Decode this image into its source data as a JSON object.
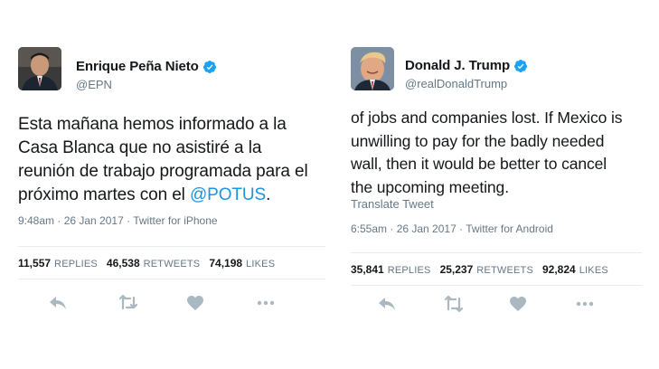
{
  "tweets": [
    {
      "display_name": "Enrique Peña Nieto",
      "handle": "@EPN",
      "text_before": "Esta mañana hemos informado a la\nCasa Blanca que no asistiré a la\nreunión de trabajo programada para el\npróximo martes con el ",
      "mention": "@POTUS",
      "text_after": ".",
      "meta": "9:48am · 26 Jan 2017 · Twitter for iPhone",
      "stats": {
        "replies_count": "11,557",
        "replies_label": "REPLIES",
        "retweets_count": "46,538",
        "retweets_label": "RETWEETS",
        "likes_count": "74,198",
        "likes_label": "LIKES"
      }
    },
    {
      "display_name": "Donald J. Trump",
      "handle": "@realDonaldTrump",
      "text": "of jobs and companies lost. If Mexico is\nunwilling to pay for the badly needed\nwall, then it would be better to cancel\nthe upcoming meeting.",
      "translate": "Translate Tweet",
      "meta": "6:55am · 26 Jan 2017 · Twitter for Android",
      "stats": {
        "replies_count": "35,841",
        "replies_label": "REPLIES",
        "retweets_count": "25,237",
        "retweets_label": "RETWEETS",
        "likes_count": "92,824",
        "likes_label": "LIKES"
      }
    }
  ],
  "icons": {
    "verified": "verified-badge",
    "reply": "reply-arrow",
    "retweet": "retweet-arrows",
    "like": "heart",
    "more": "ellipsis"
  },
  "colors": {
    "text": "#14171a",
    "secondary": "#657786",
    "link": "#1b95e0",
    "verified": "#1da1f2",
    "icon": "#aab8c2"
  }
}
